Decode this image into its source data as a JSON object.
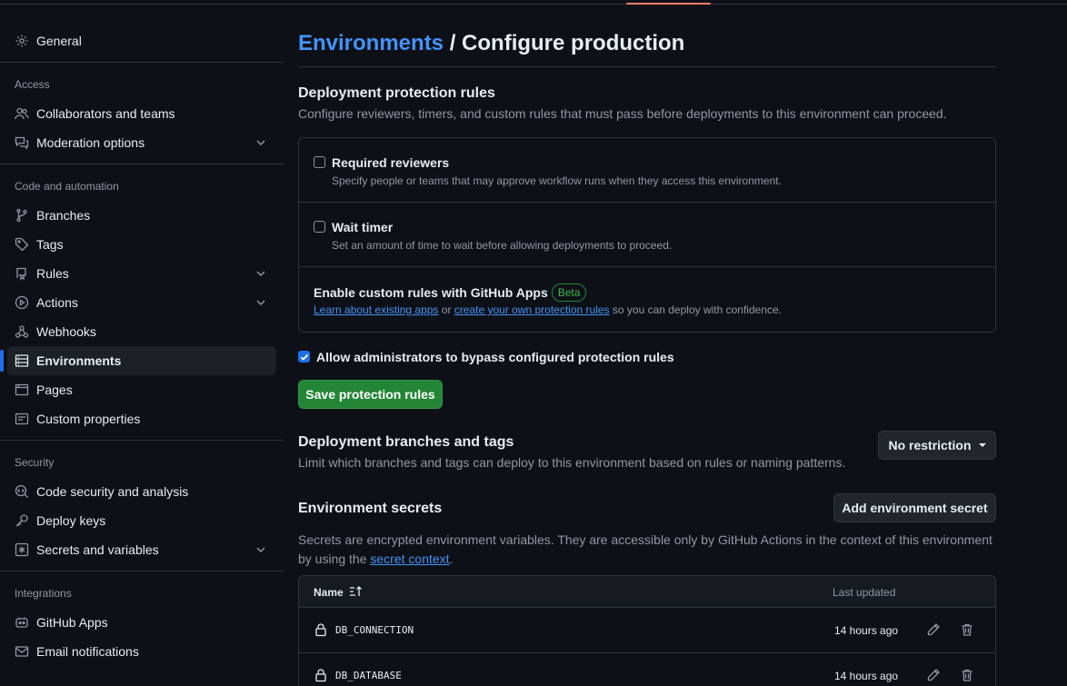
{
  "sidebar": {
    "general": "General",
    "access_title": "Access",
    "collaborators": "Collaborators and teams",
    "moderation": "Moderation options",
    "code_title": "Code and automation",
    "branches": "Branches",
    "tags": "Tags",
    "rules": "Rules",
    "actions": "Actions",
    "webhooks": "Webhooks",
    "environments": "Environments",
    "pages": "Pages",
    "custom_properties": "Custom properties",
    "security_title": "Security",
    "code_security": "Code security and analysis",
    "deploy_keys": "Deploy keys",
    "secrets": "Secrets and variables",
    "integrations_title": "Integrations",
    "github_apps": "GitHub Apps",
    "email": "Email notifications"
  },
  "header": {
    "breadcrumb_link": "Environments",
    "separator": " / ",
    "title": "Configure production"
  },
  "protection": {
    "title": "Deployment protection rules",
    "description": "Configure reviewers, timers, and custom rules that must pass before deployments to this environment can proceed.",
    "required_reviewers": {
      "label": "Required reviewers",
      "desc": "Specify people or teams that may approve workflow runs when they access this environment.",
      "checked": false
    },
    "wait_timer": {
      "label": "Wait timer",
      "desc": "Set an amount of time to wait before allowing deployments to proceed.",
      "checked": false
    },
    "custom_rules": {
      "label": "Enable custom rules with GitHub Apps",
      "badge": "Beta",
      "link1": "Learn about existing apps",
      "or": " or ",
      "link2": "create your own protection rules",
      "suffix": " so you can deploy with confidence."
    },
    "bypass": {
      "label": "Allow administrators to bypass configured protection rules",
      "checked": true
    },
    "save_button": "Save protection rules"
  },
  "branches": {
    "title": "Deployment branches and tags",
    "description": "Limit which branches and tags can deploy to this environment based on rules or naming patterns.",
    "dropdown": "No restriction"
  },
  "secrets": {
    "title": "Environment secrets",
    "add_button": "Add environment secret",
    "desc_line1": "Secrets are encrypted environment variables. They are accessible only by GitHub Actions in the context of this environment",
    "desc_line2_prefix": "by using the ",
    "desc_link": "secret context",
    "desc_suffix": ".",
    "col_name": "Name",
    "col_updated": "Last updated",
    "rows": [
      {
        "name": "DB_CONNECTION",
        "updated": "14 hours ago"
      },
      {
        "name": "DB_DATABASE",
        "updated": "14 hours ago"
      }
    ]
  },
  "colors": {
    "accent_blue": "#1f6feb",
    "link_blue": "#4493f8",
    "primary_green": "#238636",
    "tab_underline": "#f78166"
  }
}
